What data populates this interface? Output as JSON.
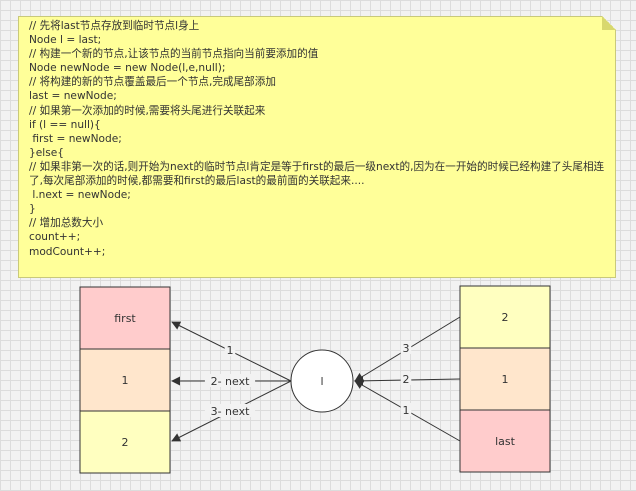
{
  "note": {
    "lines": [
      "// 先将last节点存放到临时节点l身上",
      "Node l = last;",
      "// 构建一个新的节点,让该节点的当前节点指向当前要添加的值",
      "Node newNode = new Node(l,e,null);",
      "// 将构建的新的节点覆盖最后一个节点,完成尾部添加",
      "last = newNode;",
      "// 如果第一次添加的时候,需要将头尾进行关联起来",
      "if (l == null){",
      " first = newNode;",
      "}else{",
      "// 如果非第一次的话,则开始为next的临时节点l肯定是等于first的最后一级next的,因为在一开始的时候已经构建了头尾相连了,每次尾部添加的时候,都需要和first的最后last的最前面的关联起来....",
      " l.next = newNode;",
      "}",
      "// 增加总数大小",
      "count++;",
      "modCount++;"
    ]
  },
  "left_stack": [
    {
      "label": "first",
      "color": "#ffcccc"
    },
    {
      "label": "1",
      "color": "#ffe6cc"
    },
    {
      "label": "2",
      "color": "#ffffc0"
    }
  ],
  "right_stack": [
    {
      "label": "2",
      "color": "#ffffc0"
    },
    {
      "label": "1",
      "color": "#ffe6cc"
    },
    {
      "label": "last",
      "color": "#ffcccc"
    }
  ],
  "center_node": {
    "label": "l"
  },
  "left_edges": [
    {
      "label": "1",
      "target": 0
    },
    {
      "label": "2- next",
      "target": 1
    },
    {
      "label": "3- next",
      "target": 2
    }
  ],
  "right_edges": [
    {
      "label": "3",
      "source": 0
    },
    {
      "label": "2",
      "source": 1
    },
    {
      "label": "1",
      "source": 2
    }
  ],
  "colors": {
    "stroke": "#333333",
    "note_bg": "#ffff99"
  }
}
